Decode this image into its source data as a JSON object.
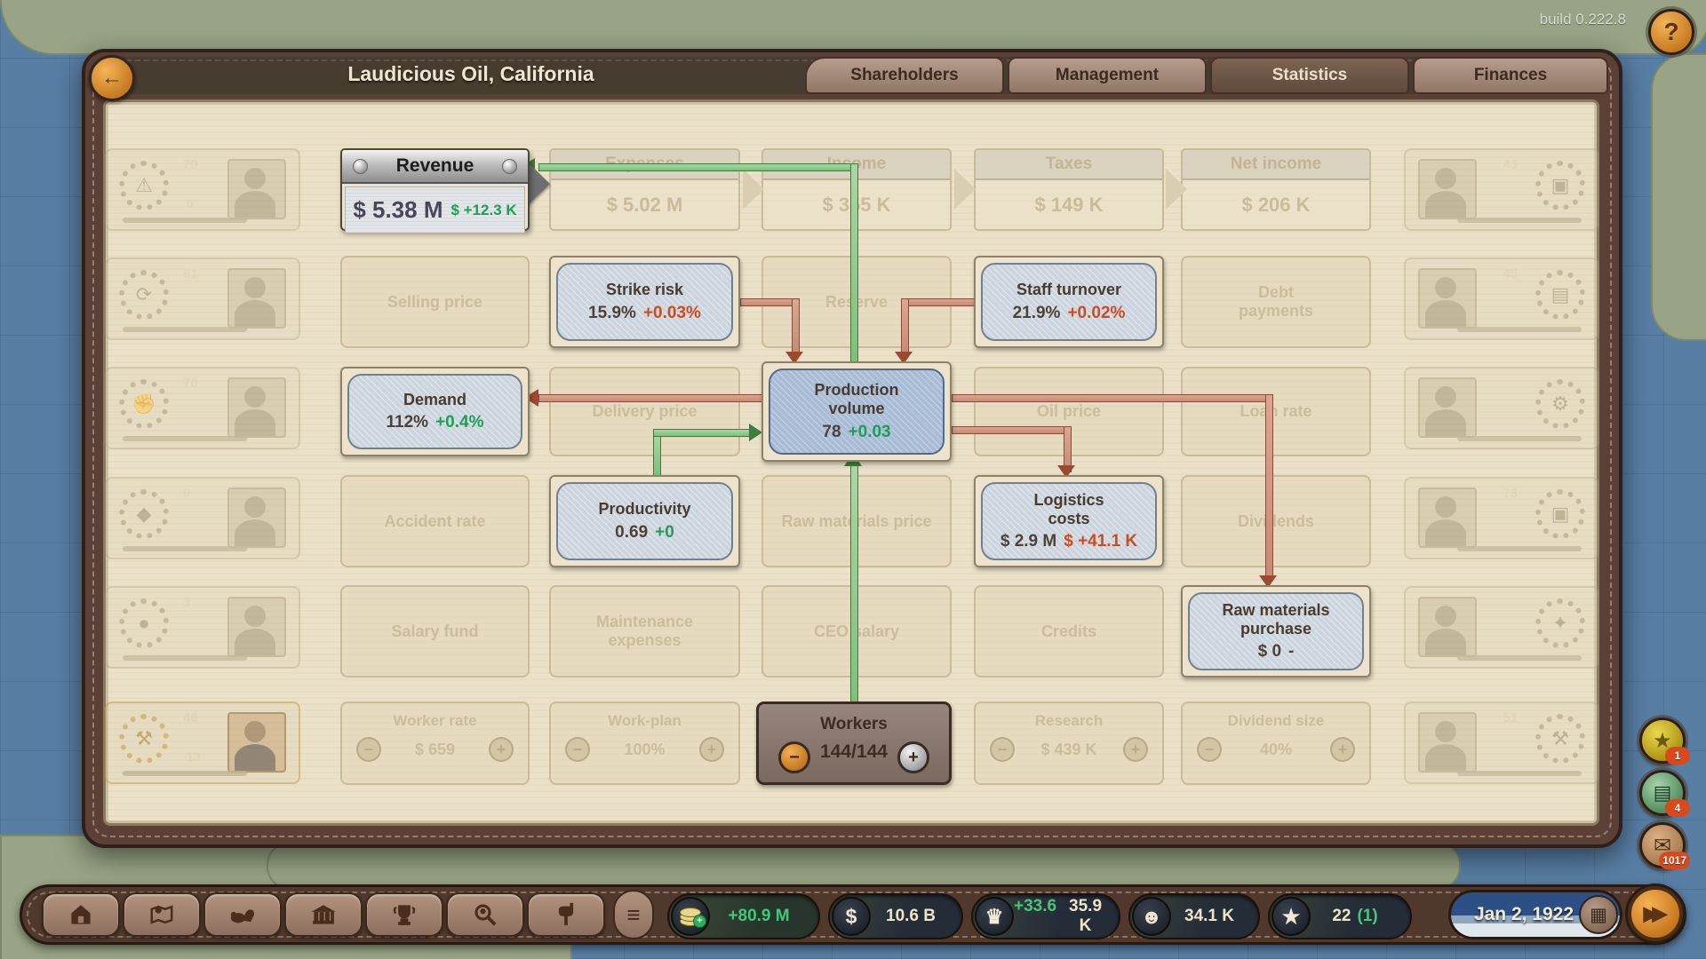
{
  "hud": {
    "build": "build 0.222.8"
  },
  "window": {
    "title": "Laudicious Oil, California",
    "tabs": [
      {
        "label": "Shareholders"
      },
      {
        "label": "Management"
      },
      {
        "label": "Statistics"
      },
      {
        "label": "Finances"
      }
    ],
    "active_tab": "Statistics"
  },
  "flow": {
    "revenue": {
      "title": "Revenue",
      "value": "$ 5.38 M",
      "delta": "$ +12.3 K"
    },
    "expenses": {
      "title": "Expenses",
      "value": "$ 5.02 M"
    },
    "income": {
      "title": "Income",
      "value": "$ 355 K"
    },
    "taxes": {
      "title": "Taxes",
      "value": "$ 149 K"
    },
    "net_income": {
      "title": "Net income",
      "value": "$ 206 K"
    },
    "strike_risk": {
      "title": "Strike risk",
      "value": "15.9%",
      "delta": "+0.03%"
    },
    "staff_turnover": {
      "title": "Staff turnover",
      "value": "21.9%",
      "delta": "+0.02%"
    },
    "demand": {
      "title": "Demand",
      "value": "112%",
      "delta": "+0.4%"
    },
    "production_volume": {
      "title": "Production volume",
      "value": "78",
      "delta": "+0.03"
    },
    "productivity": {
      "title": "Productivity",
      "value": "0.69",
      "delta": "+0"
    },
    "logistics_costs": {
      "title": "Logistics costs",
      "value": "$ 2.9 M",
      "delta": "$ +41.1 K"
    },
    "raw_materials_purchase": {
      "title": "Raw materials purchase",
      "value": "$ 0",
      "delta": "-"
    },
    "workers": {
      "title": "Workers",
      "value": "144/144"
    },
    "ghosts": {
      "selling_price": "Selling price",
      "reserve": "Reserve",
      "debt_payments": "Debt payments",
      "delivery_price": "Delivery price",
      "oil_price": "Oil price",
      "loan_rate": "Loan rate",
      "accident_rate": "Accident rate",
      "raw_materials_price": "Raw materials price",
      "dividends": "Dividends",
      "salary_fund": "Salary fund",
      "maintenance_expenses": "Maintenance expenses",
      "ceo_salary": "CEO salary",
      "credits": "Credits"
    },
    "controls": {
      "worker_rate": {
        "title": "Worker rate",
        "value": "$ 659"
      },
      "work_plan": {
        "title": "Work-plan",
        "value": "100%"
      },
      "research": {
        "title": "Research",
        "value": "$ 439 K"
      },
      "dividend_size": {
        "title": "Dividend size",
        "value": "40%"
      }
    }
  },
  "cards": {
    "left": [
      {
        "num": "79",
        "sub": "0"
      },
      {
        "num": "61",
        "sub": ""
      },
      {
        "num": "70",
        "sub": ""
      },
      {
        "num": "9",
        "sub": ""
      },
      {
        "num": "3",
        "sub": ""
      },
      {
        "num": "46",
        "sub": "13"
      }
    ],
    "right": [
      {
        "num": "43"
      },
      {
        "num": "45"
      },
      {
        "num": ""
      },
      {
        "num": "73"
      },
      {
        "num": ""
      },
      {
        "num": "51"
      }
    ]
  },
  "bottom": {
    "resources": {
      "cash_flow": "+80.9 M",
      "cash": "10.6 B",
      "influence_delta": "+33.6",
      "influence": "35.9 K",
      "population": "34.1 K",
      "stars": "22",
      "stars_extra": "(1)"
    },
    "date": "Jan 2, 1922"
  },
  "notifications": {
    "achievements": "1",
    "news": "4",
    "mail": "1017"
  },
  "icons": {
    "back": "←",
    "help": "?",
    "menu": "≡",
    "minus": "−",
    "plus": "+",
    "dollar": "$",
    "crown": "♛",
    "head": "☻",
    "star": "★",
    "news": "▤",
    "envelope": "✉",
    "calendar": "▦",
    "fast_forward": "▶▶"
  }
}
